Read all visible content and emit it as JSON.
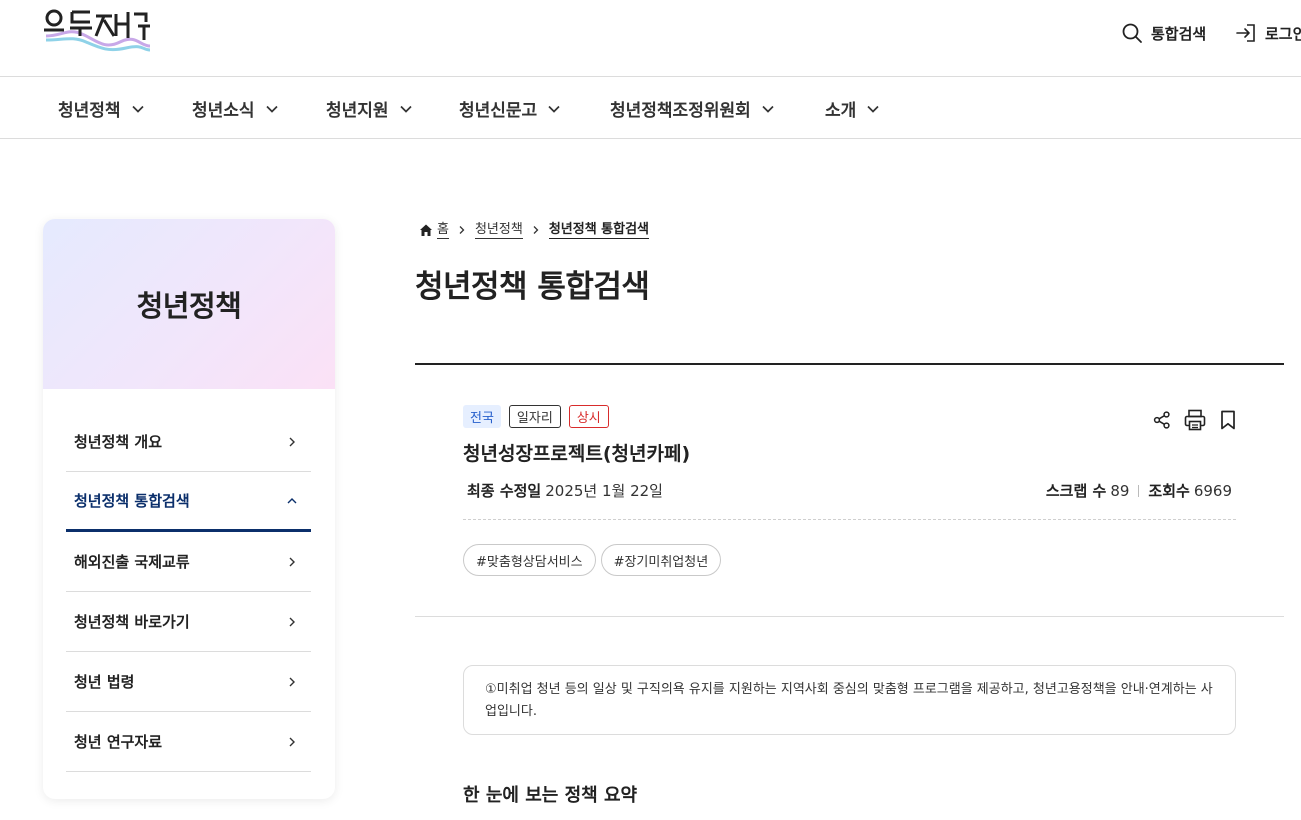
{
  "header": {
    "logo_text": "온통청년",
    "search_label": "통합검색",
    "login_label": "로그인"
  },
  "gnb": {
    "items": [
      {
        "label": "청년정책"
      },
      {
        "label": "청년소식"
      },
      {
        "label": "청년지원"
      },
      {
        "label": "청년신문고"
      },
      {
        "label": "청년정책조정위원회"
      },
      {
        "label": "소개"
      }
    ]
  },
  "sidebar": {
    "title": "청년정책",
    "items": [
      {
        "label": "청년정책 개요",
        "active": false
      },
      {
        "label": "청년정책 통합검색",
        "active": true
      },
      {
        "label": "해외진출 국제교류",
        "active": false
      },
      {
        "label": "청년정책 바로가기",
        "active": false
      },
      {
        "label": "청년 법령",
        "active": false
      },
      {
        "label": "청년 연구자료",
        "active": false
      }
    ]
  },
  "breadcrumb": {
    "home": "홈",
    "level1": "청년정책",
    "current": "청년정책 통합검색"
  },
  "page": {
    "title": "청년정책 통합검색"
  },
  "policy": {
    "badges": {
      "region": "전국",
      "category": "일자리",
      "period": "상시"
    },
    "name": "청년성장프로젝트(청년카페)",
    "updated_label": "최종 수정일",
    "updated_value": "2025년 1월 22일",
    "scrap_label": "스크랩 수",
    "scrap_value": "89",
    "views_label": "조회수",
    "views_value": "6969",
    "tags": [
      "#맞춤형상담서비스",
      "#장기미취업청년"
    ],
    "description": "①미취업 청년 등의 일상 및 구직의욕 유지를 지원하는 지역사회 중심의 맞춤형 프로그램을 제공하고, 청년고용정책을 안내·연계하는 사업입니다.",
    "summary_title": "한 눈에 보는 정책 요약"
  },
  "colors": {
    "accent": "#0b2f6b",
    "badge_blue": "#2760cc",
    "badge_red": "#d82c2c"
  },
  "icons": {
    "search": "search-icon",
    "login": "login-icon",
    "home": "home-icon",
    "share": "share-icon",
    "print": "print-icon",
    "bookmark": "bookmark-icon"
  }
}
